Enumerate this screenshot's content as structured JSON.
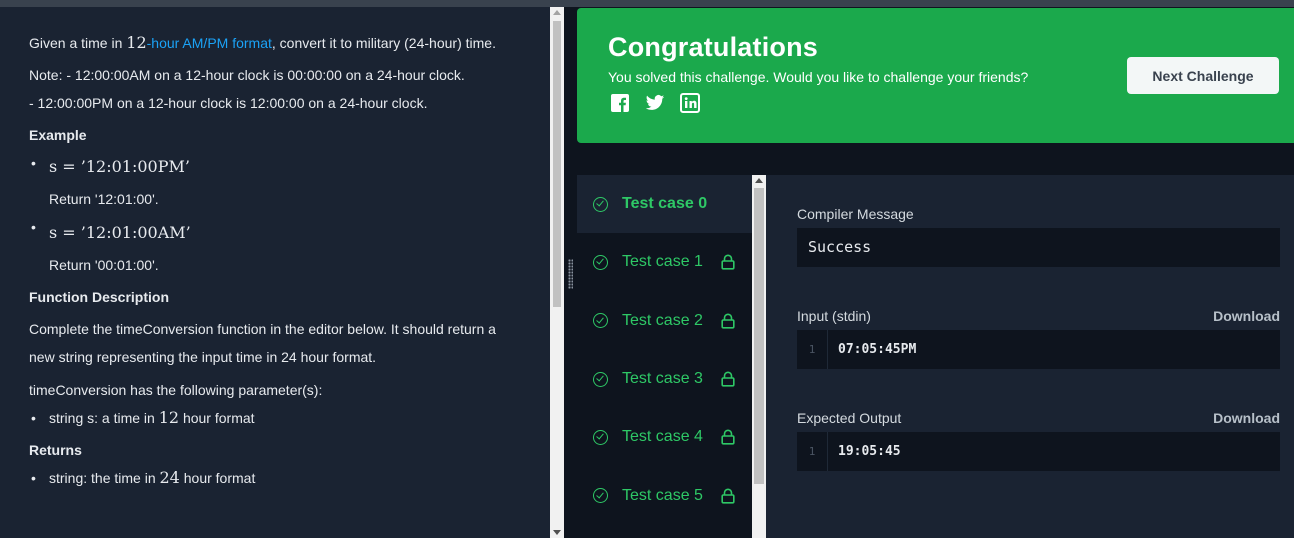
{
  "problem": {
    "intro_pre": "Given a time in ",
    "intro_math": "12",
    "intro_link": "-hour AM/PM format",
    "intro_post": ", convert it to military (24-hour) time.",
    "note1": "Note: - 12:00:00AM on a 12-hour clock is 00:00:00 on a 24-hour clock.",
    "note2": "- 12:00:00PM on a 12-hour clock is 12:00:00 on a 24-hour clock.",
    "example_heading": "Example",
    "example1_math": "s = ’12:01:00PM’",
    "example1_return": "Return '12:01:00'.",
    "example2_math": "s = ’12:01:00AM’",
    "example2_return": "Return '00:01:00'.",
    "function_heading": "Function Description",
    "function_text": "Complete the timeConversion function in the editor below. It should return a new string representing the input time in 24 hour format.",
    "params_text": "timeConversion has the following parameter(s):",
    "param1_pre": "string s: a time in ",
    "param1_math": "12",
    "param1_post": " hour format",
    "returns_heading": "Returns",
    "return1_pre": "string: the time in ",
    "return1_math": "24",
    "return1_post": " hour format"
  },
  "banner": {
    "title": "Congratulations",
    "subtitle": "You solved this challenge. Would you like to challenge your friends?",
    "social_icons": [
      "facebook-icon",
      "twitter-icon",
      "linkedin-icon"
    ],
    "next_button": "Next Challenge",
    "color": "#1ba94c"
  },
  "test_cases": [
    {
      "label": "Test case 0",
      "active": true,
      "locked": false
    },
    {
      "label": "Test case 1",
      "active": false,
      "locked": true
    },
    {
      "label": "Test case 2",
      "active": false,
      "locked": true
    },
    {
      "label": "Test case 3",
      "active": false,
      "locked": true
    },
    {
      "label": "Test case 4",
      "active": false,
      "locked": true
    },
    {
      "label": "Test case 5",
      "active": false,
      "locked": true
    }
  ],
  "results": {
    "compiler_label": "Compiler Message",
    "compiler_value": "Success",
    "input_label": "Input (stdin)",
    "input_download": "Download",
    "input_line_no": "1",
    "input_value": "07:05:45PM",
    "expected_label": "Expected Output",
    "expected_download": "Download",
    "expected_line_no": "1",
    "expected_value": "19:05:45"
  },
  "colors": {
    "success_green": "#2ec866",
    "link_blue": "#1ba2f6",
    "panel_bg": "#1a2332",
    "page_bg": "#0e141e"
  }
}
